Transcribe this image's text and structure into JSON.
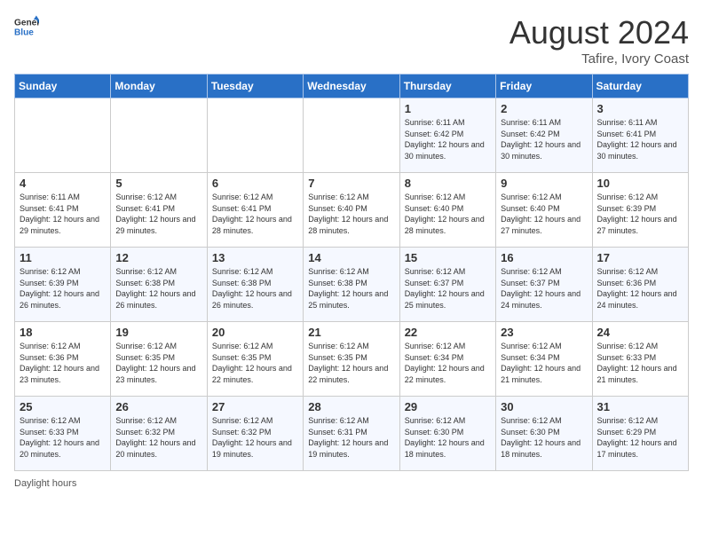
{
  "header": {
    "logo_general": "General",
    "logo_blue": "Blue",
    "month_year": "August 2024",
    "location": "Tafire, Ivory Coast"
  },
  "days_of_week": [
    "Sunday",
    "Monday",
    "Tuesday",
    "Wednesday",
    "Thursday",
    "Friday",
    "Saturday"
  ],
  "footer": {
    "label": "Daylight hours"
  },
  "weeks": [
    [
      {
        "day": "",
        "info": ""
      },
      {
        "day": "",
        "info": ""
      },
      {
        "day": "",
        "info": ""
      },
      {
        "day": "",
        "info": ""
      },
      {
        "day": "1",
        "info": "Sunrise: 6:11 AM\nSunset: 6:42 PM\nDaylight: 12 hours and 30 minutes."
      },
      {
        "day": "2",
        "info": "Sunrise: 6:11 AM\nSunset: 6:42 PM\nDaylight: 12 hours and 30 minutes."
      },
      {
        "day": "3",
        "info": "Sunrise: 6:11 AM\nSunset: 6:41 PM\nDaylight: 12 hours and 30 minutes."
      }
    ],
    [
      {
        "day": "4",
        "info": "Sunrise: 6:11 AM\nSunset: 6:41 PM\nDaylight: 12 hours and 29 minutes."
      },
      {
        "day": "5",
        "info": "Sunrise: 6:12 AM\nSunset: 6:41 PM\nDaylight: 12 hours and 29 minutes."
      },
      {
        "day": "6",
        "info": "Sunrise: 6:12 AM\nSunset: 6:41 PM\nDaylight: 12 hours and 28 minutes."
      },
      {
        "day": "7",
        "info": "Sunrise: 6:12 AM\nSunset: 6:40 PM\nDaylight: 12 hours and 28 minutes."
      },
      {
        "day": "8",
        "info": "Sunrise: 6:12 AM\nSunset: 6:40 PM\nDaylight: 12 hours and 28 minutes."
      },
      {
        "day": "9",
        "info": "Sunrise: 6:12 AM\nSunset: 6:40 PM\nDaylight: 12 hours and 27 minutes."
      },
      {
        "day": "10",
        "info": "Sunrise: 6:12 AM\nSunset: 6:39 PM\nDaylight: 12 hours and 27 minutes."
      }
    ],
    [
      {
        "day": "11",
        "info": "Sunrise: 6:12 AM\nSunset: 6:39 PM\nDaylight: 12 hours and 26 minutes."
      },
      {
        "day": "12",
        "info": "Sunrise: 6:12 AM\nSunset: 6:38 PM\nDaylight: 12 hours and 26 minutes."
      },
      {
        "day": "13",
        "info": "Sunrise: 6:12 AM\nSunset: 6:38 PM\nDaylight: 12 hours and 26 minutes."
      },
      {
        "day": "14",
        "info": "Sunrise: 6:12 AM\nSunset: 6:38 PM\nDaylight: 12 hours and 25 minutes."
      },
      {
        "day": "15",
        "info": "Sunrise: 6:12 AM\nSunset: 6:37 PM\nDaylight: 12 hours and 25 minutes."
      },
      {
        "day": "16",
        "info": "Sunrise: 6:12 AM\nSunset: 6:37 PM\nDaylight: 12 hours and 24 minutes."
      },
      {
        "day": "17",
        "info": "Sunrise: 6:12 AM\nSunset: 6:36 PM\nDaylight: 12 hours and 24 minutes."
      }
    ],
    [
      {
        "day": "18",
        "info": "Sunrise: 6:12 AM\nSunset: 6:36 PM\nDaylight: 12 hours and 23 minutes."
      },
      {
        "day": "19",
        "info": "Sunrise: 6:12 AM\nSunset: 6:35 PM\nDaylight: 12 hours and 23 minutes."
      },
      {
        "day": "20",
        "info": "Sunrise: 6:12 AM\nSunset: 6:35 PM\nDaylight: 12 hours and 22 minutes."
      },
      {
        "day": "21",
        "info": "Sunrise: 6:12 AM\nSunset: 6:35 PM\nDaylight: 12 hours and 22 minutes."
      },
      {
        "day": "22",
        "info": "Sunrise: 6:12 AM\nSunset: 6:34 PM\nDaylight: 12 hours and 22 minutes."
      },
      {
        "day": "23",
        "info": "Sunrise: 6:12 AM\nSunset: 6:34 PM\nDaylight: 12 hours and 21 minutes."
      },
      {
        "day": "24",
        "info": "Sunrise: 6:12 AM\nSunset: 6:33 PM\nDaylight: 12 hours and 21 minutes."
      }
    ],
    [
      {
        "day": "25",
        "info": "Sunrise: 6:12 AM\nSunset: 6:33 PM\nDaylight: 12 hours and 20 minutes."
      },
      {
        "day": "26",
        "info": "Sunrise: 6:12 AM\nSunset: 6:32 PM\nDaylight: 12 hours and 20 minutes."
      },
      {
        "day": "27",
        "info": "Sunrise: 6:12 AM\nSunset: 6:32 PM\nDaylight: 12 hours and 19 minutes."
      },
      {
        "day": "28",
        "info": "Sunrise: 6:12 AM\nSunset: 6:31 PM\nDaylight: 12 hours and 19 minutes."
      },
      {
        "day": "29",
        "info": "Sunrise: 6:12 AM\nSunset: 6:30 PM\nDaylight: 12 hours and 18 minutes."
      },
      {
        "day": "30",
        "info": "Sunrise: 6:12 AM\nSunset: 6:30 PM\nDaylight: 12 hours and 18 minutes."
      },
      {
        "day": "31",
        "info": "Sunrise: 6:12 AM\nSunset: 6:29 PM\nDaylight: 12 hours and 17 minutes."
      }
    ]
  ]
}
